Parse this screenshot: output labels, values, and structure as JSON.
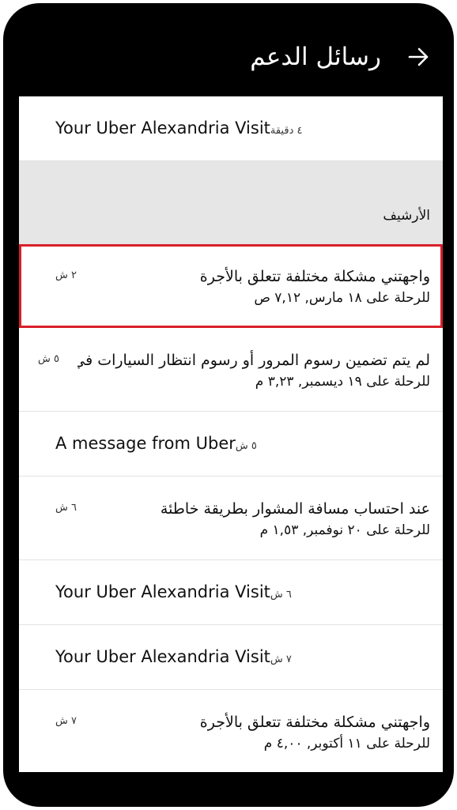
{
  "header": {
    "title": "رسائل الدعم",
    "back_icon": "arrow-right-icon"
  },
  "messages_top": [
    {
      "title": "Your Uber Alexandria Visit",
      "time": "٤ دقيقة"
    }
  ],
  "archive": {
    "label": "الأرشيف",
    "items": [
      {
        "title": "واجهتني مشكلة مختلفة تتعلق بالأجرة",
        "subtitle": "للرحلة على ١٨ مارس, ٧,١٢ ص",
        "time": "٢ ش",
        "selected": true
      },
      {
        "title": "لم يتم تضمين رسوم المرور أو رسوم انتظار السيارات في...",
        "subtitle": "للرحلة على ١٩ ديسمبر, ٣,٢٣ م",
        "time": "٥ ش"
      },
      {
        "title": "A message from Uber",
        "time": "٥ ش"
      },
      {
        "title": "عند احتساب مسافة المشوار بطريقة خاطئة",
        "subtitle": "للرحلة على ٢٠ نوفمبر, ١,٥٣ م",
        "time": "٦ ش"
      },
      {
        "title": "Your Uber Alexandria Visit",
        "time": "٦ ش"
      },
      {
        "title": "Your Uber Alexandria Visit",
        "time": "٧ ش"
      },
      {
        "title": "واجهتني مشكلة مختلفة تتعلق بالأجرة",
        "subtitle": "للرحلة على ١١ أكتوبر, ٤,٠٠ م",
        "time": "٧ ش"
      }
    ]
  },
  "colors": {
    "frame": "#000000",
    "surface": "#ffffff",
    "section_bg": "#e6e6e6",
    "selection_outline": "#d9202a"
  }
}
